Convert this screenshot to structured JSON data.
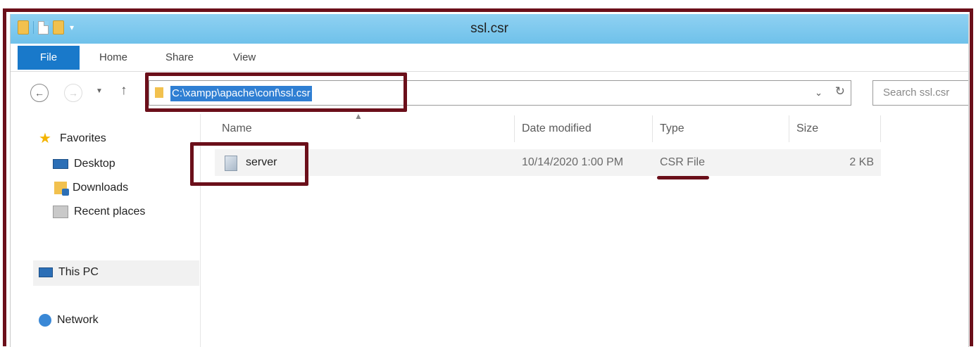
{
  "window": {
    "title": "ssl.csr"
  },
  "ribbon": {
    "tabs": [
      "File",
      "Home",
      "Share",
      "View"
    ]
  },
  "navigation": {
    "back_icon": "back-arrow-icon",
    "forward_icon": "forward-arrow-icon",
    "up_icon": "up-arrow-icon",
    "address_path": "C:\\xampp\\apache\\conf\\ssl.csr",
    "search_placeholder": "Search ssl.csr"
  },
  "sidebar": {
    "items": [
      {
        "label": "Favorites",
        "icon": "star-icon"
      },
      {
        "label": "Desktop",
        "icon": "desktop-icon"
      },
      {
        "label": "Downloads",
        "icon": "downloads-icon"
      },
      {
        "label": "Recent places",
        "icon": "recent-places-icon"
      },
      {
        "label": "This PC",
        "icon": "computer-icon"
      },
      {
        "label": "Network",
        "icon": "network-icon"
      }
    ]
  },
  "file_list": {
    "columns": [
      "Name",
      "Date modified",
      "Type",
      "Size"
    ],
    "rows": [
      {
        "name": "server",
        "date_modified": "10/14/2020 1:00 PM",
        "type": "CSR File",
        "size": "2 KB"
      }
    ]
  },
  "colors": {
    "annotation": "#6b0f1a",
    "titlebar": "#7cc8ee",
    "file_tab": "#1979ca",
    "selection": "#2f7fd3"
  }
}
